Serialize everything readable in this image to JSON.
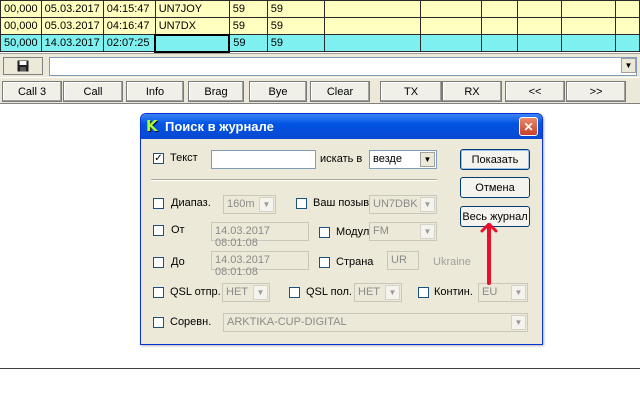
{
  "log_rows": [
    {
      "freq": "00,000",
      "date": "05.03.2017",
      "time": "04:15:47",
      "call": "UN7JOY",
      "rst_s": "59",
      "rst_r": "59",
      "style": "yellow"
    },
    {
      "freq": "00,000",
      "date": "05.03.2017",
      "time": "04:16:47",
      "call": "UN7DX",
      "rst_s": "59",
      "rst_r": "59",
      "style": "yellow"
    },
    {
      "freq": "50,000",
      "date": "14.03.2017",
      "time": "02:07:25",
      "call": "",
      "rst_s": "59",
      "rst_r": "59",
      "style": "cyan"
    }
  ],
  "command_bar": {
    "input_value": ""
  },
  "buttons": [
    "Call 3",
    "Call",
    "Info",
    "Brag",
    "Bye",
    "Clear",
    "TX",
    "RX",
    "<<",
    ">>"
  ],
  "dialog": {
    "title": "Поиск в журнале",
    "text_label": "Текст",
    "text_value": "",
    "search_in_label": "искать в",
    "search_in_value": "везде",
    "show_button": "Показать",
    "cancel_button": "Отмена",
    "whole_log_button": "Весь журнал",
    "band_label": "Диапаз.",
    "band_value": "160m",
    "your_call_label": "Ваш позыв.",
    "your_call_value": "UN7DBK",
    "from_label": "От",
    "from_value": "14.03.2017 08:01:08",
    "mode_label": "Модул",
    "mode_value": "FM",
    "to_label": "До",
    "to_value": "14.03.2017 08:01:08",
    "country_label": "Страна",
    "country_code": "UR",
    "country_name": "Ukraine",
    "qsl_sent_label": "QSL отпр.",
    "qsl_sent_value": "НЕТ",
    "qsl_rcvd_label": "QSL пол.",
    "qsl_rcvd_value": "НЕТ",
    "continent_label": "Контин.",
    "continent_value": "EU",
    "contest_label": "Соревн.",
    "contest_value": "ARKTIKA-CUP-DIGITAL"
  },
  "colors": {
    "row_yellow": "#ffffc0",
    "row_cyan": "#7ff0f0",
    "title_blue": "#0054e3",
    "arrow_red": "#e8102a"
  }
}
